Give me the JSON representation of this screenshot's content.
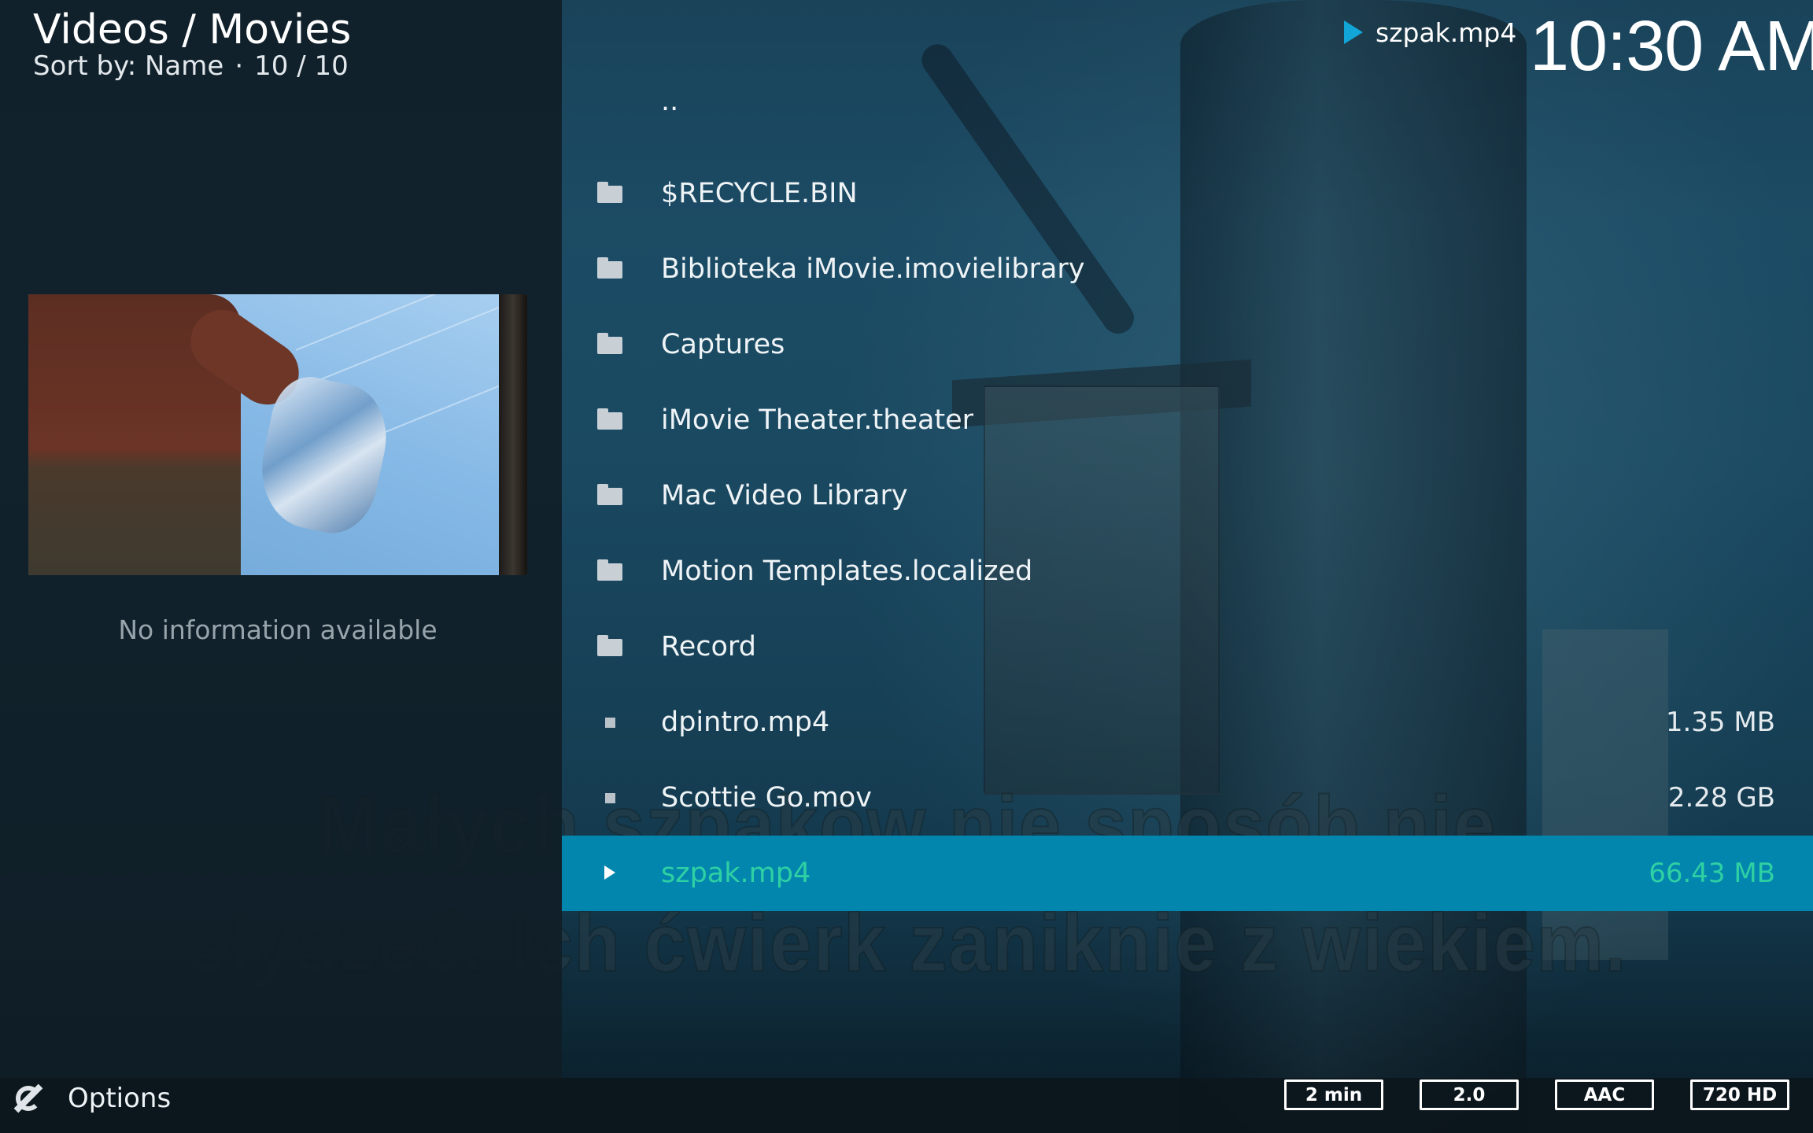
{
  "header": {
    "path": "Videos / Movies",
    "sort_label": "Sort by: Name",
    "separator": "·",
    "item_count": "10 / 10"
  },
  "now_playing": {
    "icon": "play-indicator-icon",
    "filename": "szpak.mp4"
  },
  "clock": "10:30 AM",
  "info_panel": {
    "no_info_text": "No information available"
  },
  "file_list": {
    "parent": "..",
    "items": [
      {
        "label": "$RECYCLE.BIN",
        "type": "folder",
        "icon": "folder-icon",
        "size": ""
      },
      {
        "label": "Biblioteka iMovie.imovielibrary",
        "type": "folder",
        "icon": "folder-icon",
        "size": ""
      },
      {
        "label": "Captures",
        "type": "folder",
        "icon": "folder-icon",
        "size": ""
      },
      {
        "label": "iMovie Theater.theater",
        "type": "folder",
        "icon": "folder-icon",
        "size": ""
      },
      {
        "label": "Mac Video Library",
        "type": "folder",
        "icon": "folder-icon",
        "size": ""
      },
      {
        "label": "Motion Templates.localized",
        "type": "folder",
        "icon": "folder-icon",
        "size": ""
      },
      {
        "label": "Record",
        "type": "folder",
        "icon": "folder-icon",
        "size": ""
      },
      {
        "label": "dpintro.mp4",
        "type": "file",
        "icon": "file-icon",
        "size": "1.35 MB"
      },
      {
        "label": "Scottie Go.mov",
        "type": "file",
        "icon": "file-icon",
        "size": "2.28 GB"
      },
      {
        "label": "szpak.mp4",
        "type": "playing",
        "icon": "play-icon",
        "size": "66.43 MB",
        "selected": true
      }
    ]
  },
  "subtitles": {
    "line1": "Małych szpaków nie sposób nie",
    "line2": "słyszeć. Ich ćwierk zaniknie z wiekiem."
  },
  "footer": {
    "options_icon": "options-icon",
    "options_label": "Options",
    "badges": [
      "2 min",
      "2.0",
      "AAC",
      "720 HD"
    ]
  },
  "colors": {
    "accent": "#12a6d8",
    "selected_row": "#0286ad",
    "selected_text": "#2fd0a4"
  }
}
